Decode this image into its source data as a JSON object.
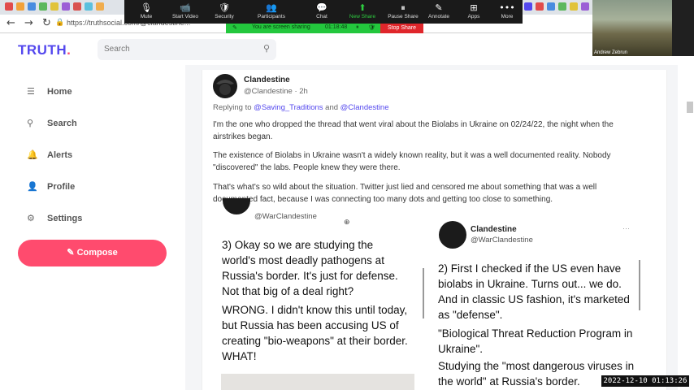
{
  "browser": {
    "url": "https://truthsocial.com/@clandestine...",
    "back_icon": "←",
    "forward_icon": "→",
    "reload_icon": "↻"
  },
  "zoom": {
    "tools": [
      {
        "icon": "🎙",
        "label": "Mute"
      },
      {
        "icon": "📹",
        "label": "Start Video"
      },
      {
        "icon": "🛡",
        "label": "Security"
      },
      {
        "icon": "👥",
        "label": "Participants"
      },
      {
        "icon": "💬",
        "label": "Chat"
      },
      {
        "icon": "⬆",
        "label": "New Share"
      },
      {
        "icon": "⏸",
        "label": "Pause Share"
      },
      {
        "icon": "✎",
        "label": "Annotate"
      },
      {
        "icon": "⊞",
        "label": "Apps"
      },
      {
        "icon": "•••",
        "label": "More"
      }
    ],
    "share_status": "You are screen sharing",
    "share_time": "01:18:48",
    "stop_share": "Stop Share",
    "video_name": "Andrew Zebrun"
  },
  "truth": {
    "logo": "TRUTH",
    "logo_dot": ".",
    "search_placeholder": "Search",
    "nav": [
      {
        "label": "Home",
        "icon": "☰"
      },
      {
        "label": "Search",
        "icon": "⚲"
      },
      {
        "label": "Alerts",
        "icon": "🔔"
      },
      {
        "label": "Profile",
        "icon": "👤"
      },
      {
        "label": "Settings",
        "icon": "⚙"
      }
    ],
    "compose": "Compose",
    "compose_icon": "✎"
  },
  "post": {
    "name": "Clandestine",
    "handle": "@Clandestine · 2h",
    "reply_prefix": "Replying to",
    "reply_to_1": "@Saving_Traditions",
    "reply_and": "and",
    "reply_to_2": "@Clandestine",
    "paragraphs": [
      "I'm the one who dropped the thread that went viral about the Biolabs in Ukraine on 02/24/22, the night when the airstrikes began.",
      "The existence of Biolabs in Ukraine wasn't a widely known reality, but it was a well documented reality. Nobody \"discovered\" the labs. People knew they were there.",
      "That's what's so wild about the situation. Twitter just lied and censored me about something that was a well documented fact, because I was connecting too many dots and getting too close to something."
    ]
  },
  "embed_left": {
    "handle": "@WarClandestine",
    "para1": "3) Okay so we are studying the world's most deadly pathogens at Russia's border. It's just for defense. Not that big of a deal right?",
    "para2": "WRONG. I didn't know this until today, but Russia has been accusing US of creating \"bio-weapons\" at their border. WHAT!"
  },
  "embed_right": {
    "name": "Clandestine",
    "handle": "@WarClandestine",
    "more": "···",
    "para1": "2) First I checked if the US even have biolabs in Ukraine. Turns out... we do. And in classic US fashion, it's marketed as \"defense\".",
    "para2": "\"Biological Threat Reduction Program in Ukraine\".",
    "para3": "Studying the \"most dangerous viruses in the world\" at Russia's border."
  },
  "timestamp": "2022-12-10 01:13:26"
}
